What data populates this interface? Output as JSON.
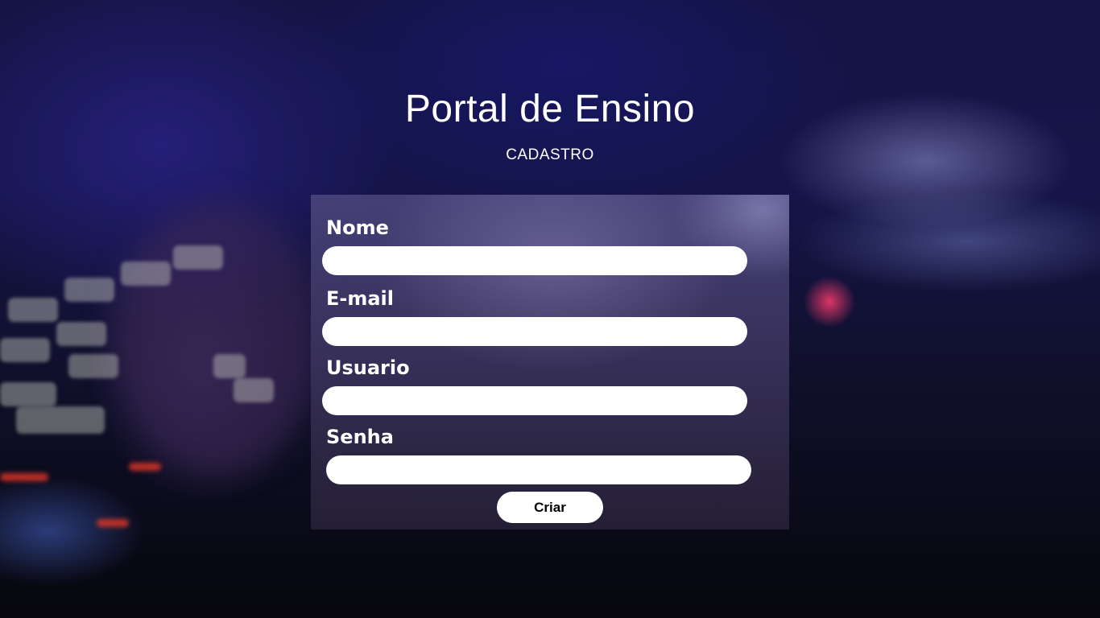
{
  "page": {
    "title": "Portal de Ensino",
    "subtitle": "CADASTRO"
  },
  "form": {
    "fields": [
      {
        "label": "Nome",
        "value": "",
        "placeholder": ""
      },
      {
        "label": "E-mail",
        "value": "",
        "placeholder": ""
      },
      {
        "label": "Usuario",
        "value": "",
        "placeholder": ""
      },
      {
        "label": "Senha",
        "value": "",
        "placeholder": ""
      }
    ],
    "submit_label": "Criar"
  },
  "colors": {
    "panel": "#3c345f",
    "field_background": "#ffffff",
    "text": "#ffffff",
    "button_text": "#000000"
  }
}
